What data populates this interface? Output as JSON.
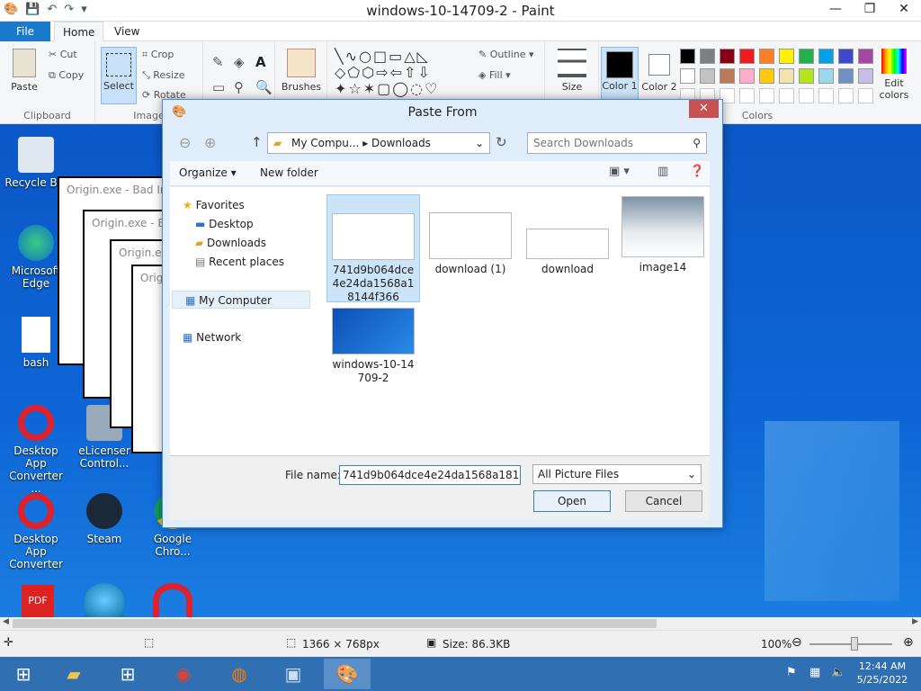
{
  "window": {
    "title": "windows-10-14709-2 - Paint",
    "minimize": "—",
    "maximize": "❐",
    "close": "✕"
  },
  "menu": {
    "file": "File",
    "home": "Home",
    "view": "View"
  },
  "ribbon": {
    "clipboard": {
      "label": "Clipboard",
      "paste": "Paste",
      "cut": "Cut",
      "copy": "Copy"
    },
    "image": {
      "label": "Image",
      "select": "Select",
      "crop": "Crop",
      "resize": "Resize",
      "rotate": "Rotate"
    },
    "brushes": "Brushes",
    "shapes": {
      "outline": "Outline",
      "fill": "Fill"
    },
    "size": "Size",
    "color1": "Color 1",
    "color2": "Color 2",
    "colors_label": "Colors",
    "edit_colors": "Edit colors",
    "palette": [
      "#000000",
      "#7f7f7f",
      "#880015",
      "#ed1c24",
      "#ff7f27",
      "#fff200",
      "#22b14c",
      "#00a2e8",
      "#3f48cc",
      "#a349a4",
      "#ffffff",
      "#c3c3c3",
      "#b97a57",
      "#ffaec9",
      "#ffc90e",
      "#efe4b0",
      "#b5e61d",
      "#99d9ea",
      "#7092be",
      "#c8bfe7"
    ]
  },
  "desktop": {
    "icons": [
      {
        "label": "Recycle Bin"
      },
      {
        "label": "Microsoft Edge"
      },
      {
        "label": "bash"
      },
      {
        "label": "Desktop App Converter ..."
      },
      {
        "label": "eLicenser Control..."
      },
      {
        "label": "Desktop App Converter"
      },
      {
        "label": "Steam"
      },
      {
        "label": "Google Chro..."
      }
    ],
    "error_windows": [
      "Origin.exe - Bad Ima",
      "Origin.exe - Ba",
      "Origin.exe",
      "Origi"
    ]
  },
  "dialog": {
    "title": "Paste From",
    "address": {
      "root": "My Compu...",
      "folder": "Downloads"
    },
    "search_placeholder": "Search Downloads",
    "organize": "Organize ▾",
    "new_folder": "New folder",
    "nav": {
      "favorites": "Favorites",
      "desktop": "Desktop",
      "downloads": "Downloads",
      "recent": "Recent places",
      "computer": "My Computer",
      "network": "Network"
    },
    "files": [
      {
        "name": "741d9b064dce4e24da1568a18144f366"
      },
      {
        "name": "download (1)"
      },
      {
        "name": "download"
      },
      {
        "name": "image14"
      },
      {
        "name": "windows-10-14709-2"
      }
    ],
    "filename_label": "File name:",
    "filename_value": "741d9b064dce4e24da1568a18144f366",
    "filetype": "All Picture Files",
    "open": "Open",
    "cancel": "Cancel"
  },
  "status": {
    "dimensions": "1366 × 768px",
    "size": "Size: 86.3KB",
    "zoom": "100%"
  },
  "taskbar": {
    "time": "12:44 AM",
    "date": "5/25/2022"
  }
}
